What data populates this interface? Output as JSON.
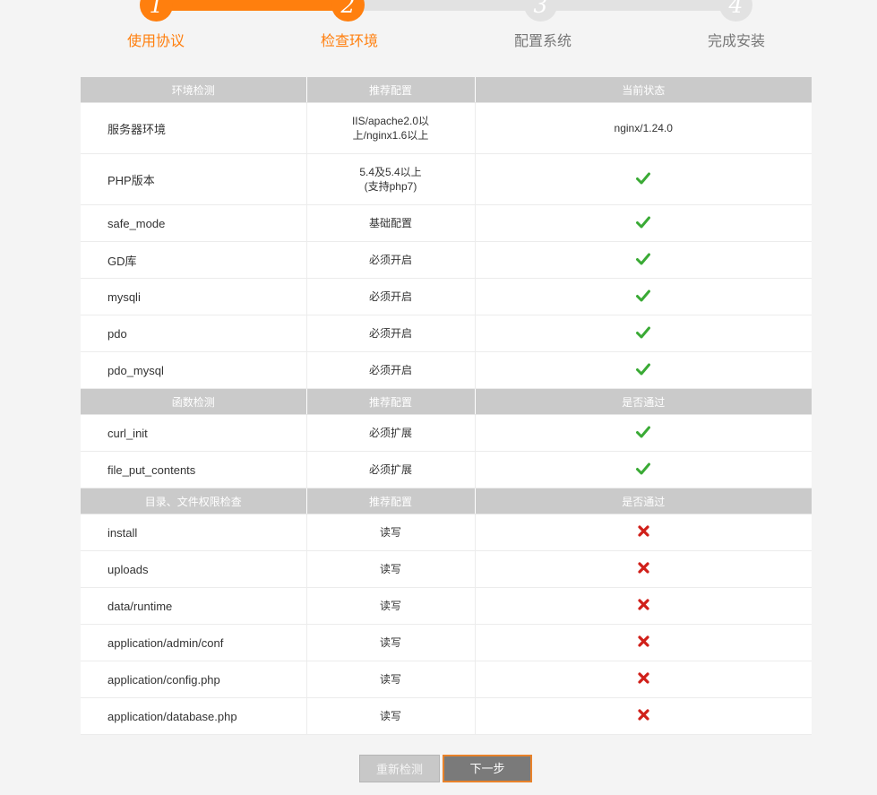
{
  "steps": [
    {
      "number": "1",
      "label": "使用协议",
      "state": "done"
    },
    {
      "number": "2",
      "label": "检查环境",
      "state": "done"
    },
    {
      "number": "3",
      "label": "配置系统",
      "state": "todo"
    },
    {
      "number": "4",
      "label": "完成安装",
      "state": "todo"
    }
  ],
  "colors": {
    "accent": "#ff7f0e",
    "inactive": "#e2e2e2",
    "header_bg": "#cacaca",
    "ok": "#3aaa35",
    "fail": "#d0201a"
  },
  "env_section": {
    "headers": [
      "环境检测",
      "推荐配置",
      "当前状态"
    ],
    "rows": [
      {
        "name": "服务器环境",
        "recommended": "IIS/apache2.0以\n上/nginx1.6以上",
        "status": "nginx/1.24.0",
        "icon": "text"
      },
      {
        "name": "PHP版本",
        "recommended": "5.4及5.4以上\n(支持php7)",
        "status": "",
        "icon": "check-icon"
      },
      {
        "name": "safe_mode",
        "recommended": "基础配置",
        "status": "",
        "icon": "check-icon"
      },
      {
        "name": "GD库",
        "recommended": "必须开启",
        "status": "",
        "icon": "check-icon"
      },
      {
        "name": "mysqli",
        "recommended": "必须开启",
        "status": "",
        "icon": "check-icon"
      },
      {
        "name": "pdo",
        "recommended": "必须开启",
        "status": "",
        "icon": "check-icon"
      },
      {
        "name": "pdo_mysql",
        "recommended": "必须开启",
        "status": "",
        "icon": "check-icon"
      }
    ]
  },
  "func_section": {
    "headers": [
      "函数检测",
      "推荐配置",
      "是否通过"
    ],
    "rows": [
      {
        "name": "curl_init",
        "recommended": "必须扩展",
        "icon": "check-icon"
      },
      {
        "name": "file_put_contents",
        "recommended": "必须扩展",
        "icon": "check-icon"
      }
    ]
  },
  "dir_section": {
    "headers": [
      "目录、文件权限检查",
      "推荐配置",
      "是否通过"
    ],
    "rows": [
      {
        "name": "install",
        "recommended": "读写",
        "icon": "cross-icon"
      },
      {
        "name": "uploads",
        "recommended": "读写",
        "icon": "cross-icon"
      },
      {
        "name": "data/runtime",
        "recommended": "读写",
        "icon": "cross-icon"
      },
      {
        "name": "application/admin/conf",
        "recommended": "读写",
        "icon": "cross-icon"
      },
      {
        "name": "application/config.php",
        "recommended": "读写",
        "icon": "cross-icon"
      },
      {
        "name": "application/database.php",
        "recommended": "读写",
        "icon": "cross-icon"
      }
    ]
  },
  "buttons": {
    "recheck_label": "重新检测",
    "next_label": "下一步"
  }
}
